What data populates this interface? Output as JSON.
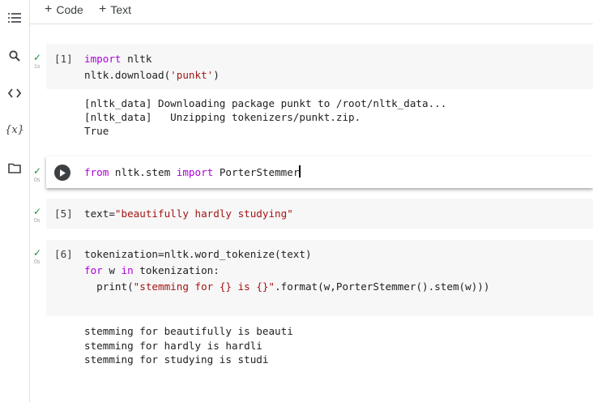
{
  "toolbar": {
    "add_code": "Code",
    "add_text": "Text"
  },
  "sidebar": {
    "icons": [
      "menu-icon",
      "search-icon",
      "code-snippets-icon",
      "variables-icon",
      "folder-icon"
    ],
    "variables_glyph": "{x}"
  },
  "cells": [
    {
      "prompt": "[1]",
      "time": "1s",
      "code_lines": [
        [
          {
            "t": "import",
            "c": "kw"
          },
          {
            "t": " nltk",
            "c": "fn"
          }
        ],
        [
          {
            "t": "nltk.download(",
            "c": "fn"
          },
          {
            "t": "'punkt'",
            "c": "str"
          },
          {
            "t": ")",
            "c": "fn"
          }
        ]
      ],
      "output_lines": [
        "[nltk_data] Downloading package punkt to /root/nltk_data...",
        "[nltk_data]   Unzipping tokenizers/punkt.zip.",
        "True"
      ]
    },
    {
      "prompt": "",
      "time": "0s",
      "code_lines": [
        [
          {
            "t": "from",
            "c": "kw"
          },
          {
            "t": " nltk.stem ",
            "c": "fn"
          },
          {
            "t": "import",
            "c": "kw"
          },
          {
            "t": " PorterStemmer",
            "c": "fn"
          }
        ]
      ],
      "output_lines": []
    },
    {
      "prompt": "[5]",
      "time": "0s",
      "code_lines": [
        [
          {
            "t": "text=",
            "c": "fn"
          },
          {
            "t": "\"beautifully hardly studying\"",
            "c": "str"
          }
        ]
      ],
      "output_lines": []
    },
    {
      "prompt": "[6]",
      "time": "0s",
      "code_lines": [
        [
          {
            "t": "tokenization=nltk.word_tokenize(text)",
            "c": "fn"
          }
        ],
        [
          {
            "t": "for",
            "c": "kw"
          },
          {
            "t": " w ",
            "c": "fn"
          },
          {
            "t": "in",
            "c": "kw"
          },
          {
            "t": " tokenization:",
            "c": "fn"
          }
        ],
        [
          {
            "t": "  print(",
            "c": "fn"
          },
          {
            "t": "\"stemming for {} is {}\"",
            "c": "str"
          },
          {
            "t": ".format(w,PorterStemmer().stem(w)))",
            "c": "fn"
          }
        ]
      ],
      "output_lines": [
        "stemming for beautifully is beauti",
        "stemming for hardly is hardli",
        "stemming for studying is studi"
      ]
    }
  ]
}
